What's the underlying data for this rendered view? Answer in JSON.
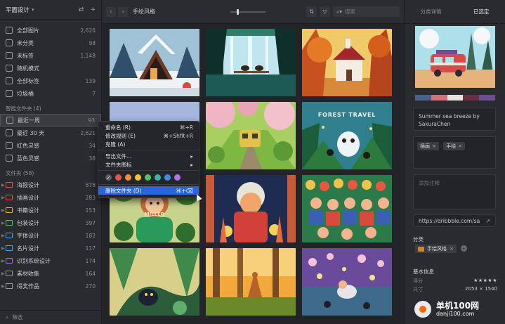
{
  "sidebar": {
    "title": "平面设计",
    "library": [
      {
        "label": "全部图片",
        "count": "2,626",
        "icon": "all-images-icon"
      },
      {
        "label": "未分类",
        "count": "98",
        "icon": "unfiled-icon"
      },
      {
        "label": "未标签",
        "count": "1,148",
        "icon": "untagged-icon"
      },
      {
        "label": "随机模式",
        "count": "",
        "icon": "random-icon"
      },
      {
        "label": "全部标签",
        "count": "139",
        "icon": "tag-icon"
      },
      {
        "label": "垃圾桶",
        "count": "7",
        "icon": "trash-icon"
      }
    ],
    "smart_header": "智能文件夹 (4)",
    "smart": [
      {
        "label": "最近一周",
        "count": "93"
      },
      {
        "label": "最近 30 天",
        "count": "2,621"
      },
      {
        "label": "红色灵感",
        "count": "34"
      },
      {
        "label": "蓝色灵感",
        "count": "38"
      }
    ],
    "folders_header": "文件夹 (58)",
    "folders": [
      {
        "label": "海报设计",
        "count": "878",
        "color": "#e0564f"
      },
      {
        "label": "插画设计",
        "count": "283",
        "color": "#e0564f"
      },
      {
        "label": "书籍设计",
        "count": "153",
        "color": "#f0b23a"
      },
      {
        "label": "包装设计",
        "count": "397",
        "color": "#59c36a"
      },
      {
        "label": "字体设计",
        "count": "182",
        "color": "#4aa3ef"
      },
      {
        "label": "名片设计",
        "count": "117",
        "color": "#4aa3ef"
      },
      {
        "label": "识别系统设计",
        "count": "174",
        "color": "#b06ae8"
      },
      {
        "label": "素材收集",
        "count": "164",
        "color": "#9a9b9f"
      },
      {
        "label": "得奖作品",
        "count": "270",
        "color": "#9a9b9f"
      }
    ],
    "filter_label": "筛选"
  },
  "toolbar": {
    "title": "手绘风格",
    "back": "‹",
    "forward": "›",
    "search_placeholder": "搜索",
    "zoom_level": 0.2
  },
  "context_menu": {
    "items": [
      {
        "label": "重命名 (R)",
        "shortcut": "⌘+R"
      },
      {
        "label": "修改规则 (E)",
        "shortcut": "⌘+Shfit+R"
      },
      {
        "label": "克隆 (A)",
        "shortcut": ""
      },
      {
        "label": "导出文件...",
        "shortcut": "▸"
      },
      {
        "label": "文件夹图标",
        "shortcut": "▸"
      }
    ],
    "colors": [
      "#e6544f",
      "#f08d3b",
      "#f3c23b",
      "#52c45e",
      "#38b6a6",
      "#3d8be8",
      "#b271e6"
    ],
    "delete_label": "删除文件夹 (D)",
    "delete_shortcut": "⌘+⌫"
  },
  "thumbs_text": {
    "forest_title": "FOREST TRAVEL",
    "miller": "MILLER"
  },
  "panel": {
    "tab_detail": "分类详情",
    "tab_selected": "已选定",
    "palette": [
      "#4d5f8f",
      "#d4707a",
      "#e6e2e2",
      "#6a2f40",
      "#6b4e92"
    ],
    "annotation": "Summer sea breeze by SakuraChen",
    "tags": [
      "插画",
      "手绘"
    ],
    "note_placeholder": "添加注释",
    "url": "https://dribbble.com/sa",
    "folder_label": "分类",
    "folder_chip": "手绘风格",
    "info_label": "基本信息",
    "rating_label": "评分",
    "rating": "★★★★★",
    "size_label": "尺寸",
    "size_value": "2053 × 1540"
  },
  "watermark": {
    "line1": "单机100网",
    "line2": "danji100.com"
  }
}
